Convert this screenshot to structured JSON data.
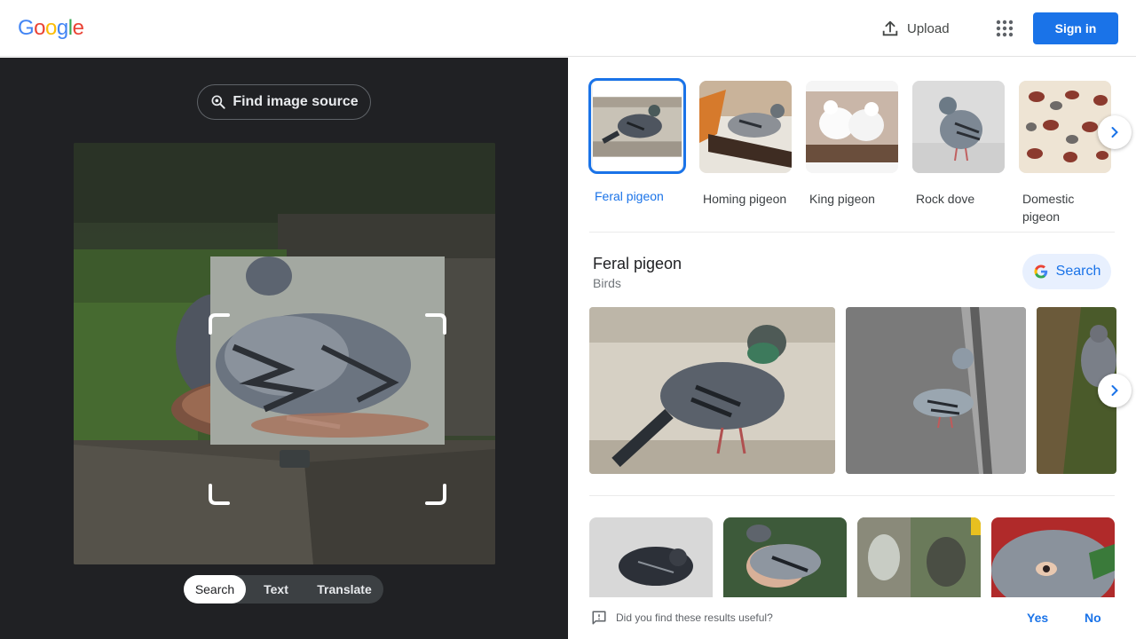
{
  "header": {
    "logo_letters": [
      {
        "char": "G",
        "color": "#4285F4"
      },
      {
        "char": "o",
        "color": "#EA4335"
      },
      {
        "char": "o",
        "color": "#FBBC05"
      },
      {
        "char": "g",
        "color": "#4285F4"
      },
      {
        "char": "l",
        "color": "#34A853"
      },
      {
        "char": "e",
        "color": "#EA4335"
      }
    ],
    "upload_label": "Upload",
    "apps_icon": "apps-grid-icon",
    "signin_label": "Sign in"
  },
  "left": {
    "find_source_label": "Find image source",
    "tabs": [
      {
        "label": "Search",
        "active": true
      },
      {
        "label": "Text",
        "active": false
      },
      {
        "label": "Translate",
        "active": false
      }
    ]
  },
  "right": {
    "thumbs": [
      {
        "label": "Feral pigeon",
        "selected": true
      },
      {
        "label": "Homing pigeon",
        "selected": false
      },
      {
        "label": "King pigeon",
        "selected": false
      },
      {
        "label": "Rock dove",
        "selected": false
      },
      {
        "label": "Domestic pigeon",
        "selected": false
      }
    ],
    "kg": {
      "title": "Feral pigeon",
      "subtitle": "Birds",
      "search_label": "Search"
    },
    "feedback": {
      "question": "Did you find these results useful?",
      "yes": "Yes",
      "no": "No"
    }
  },
  "colors": {
    "accent": "#1a73e8",
    "dark_bg": "#202124"
  }
}
